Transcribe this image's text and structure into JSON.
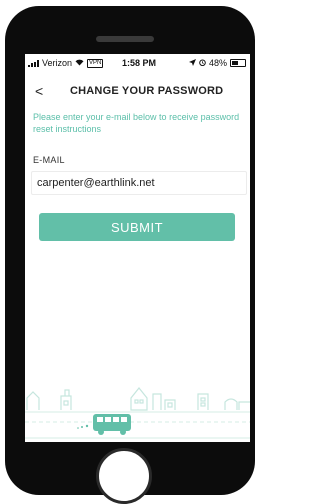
{
  "status_bar": {
    "carrier": "Verizon",
    "network_badge": "VPN",
    "time": "1:58 PM",
    "battery_percent": "48%"
  },
  "header": {
    "back_glyph": "<",
    "title": "CHANGE YOUR PASSWORD"
  },
  "form": {
    "instructions": "Please enter your e-mail below to receive password reset instructions",
    "email_label": "E-MAIL",
    "email_value": "carpenter@earthlink.net",
    "submit_label": "SUBMIT"
  },
  "colors": {
    "accent": "#62bfa8",
    "instruction_text": "#5bbfa9",
    "illustration": "#c6e6de"
  },
  "icons": [
    "signal-icon",
    "wifi-icon",
    "vpn-badge",
    "location-icon",
    "alarm-icon",
    "battery-icon",
    "back-icon",
    "town-illustration",
    "bus-icon"
  ]
}
